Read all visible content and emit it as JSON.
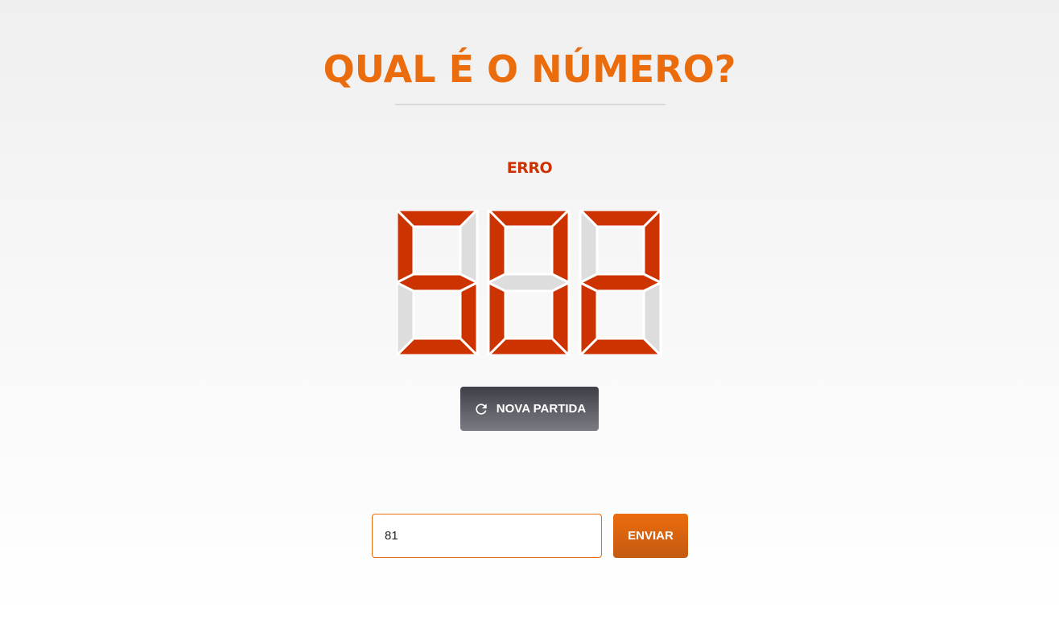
{
  "header": {
    "title": "QUAL É O NÚMERO?"
  },
  "status": {
    "text": "ERRO",
    "color": "#cc3300"
  },
  "display": {
    "value": "502",
    "on_color": "#cc3300",
    "off_color": "#dddddd"
  },
  "actions": {
    "new_game_label": "NOVA PARTIDA",
    "new_game_icon": "refresh-icon"
  },
  "guess_form": {
    "input_value": "81",
    "send_label": "ENVIAR"
  },
  "colors": {
    "accent": "#eb6c0d"
  }
}
